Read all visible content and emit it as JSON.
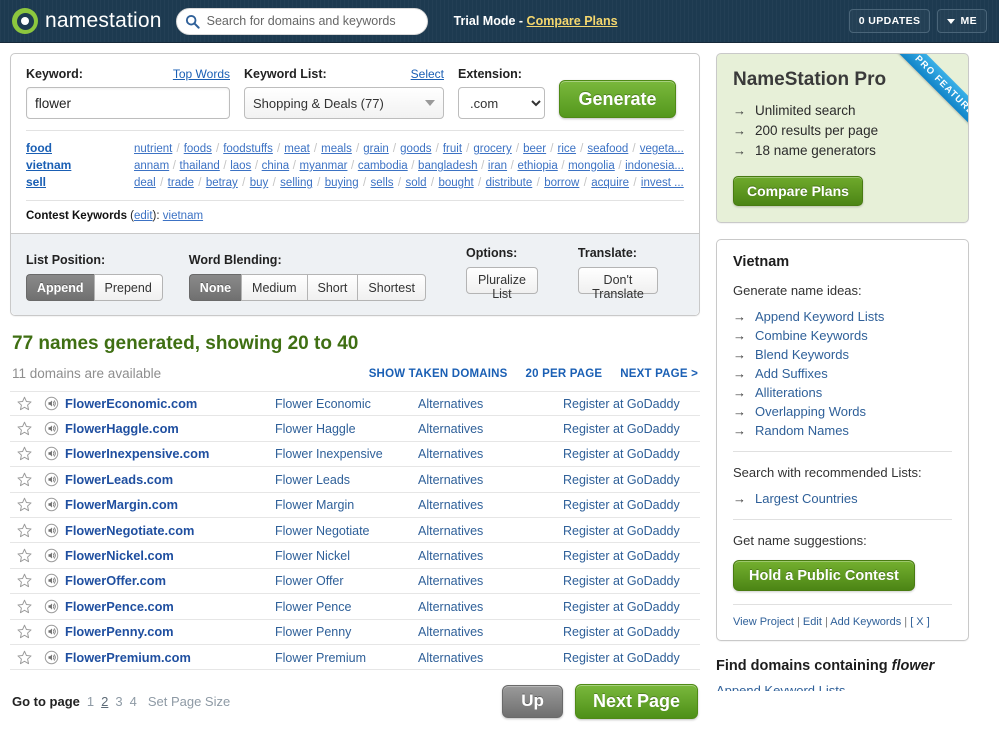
{
  "topbar": {
    "logo_text": "namestation",
    "logo_icon": "namestation-circle-logo",
    "search_placeholder": "Search for domains and keywords",
    "search_value": "",
    "search_icon": "search-icon",
    "trial_prefix": "Trial Mode - ",
    "trial_link": "Compare Plans",
    "updates_label": "0 UPDATES",
    "me_label": "ME",
    "me_caret_icon": "chevron-down-icon"
  },
  "generator": {
    "keyword_label": "Keyword:",
    "top_words_link": "Top Words",
    "keyword_value": "flower",
    "keyword_list_label": "Keyword List:",
    "select_link": "Select",
    "keyword_list_value": "Shopping & Deals (77)",
    "keyword_list_options": [
      "Shopping & Deals (77)"
    ],
    "extension_label": "Extension:",
    "extension_value": ".com",
    "extension_options": [
      ".com"
    ],
    "generate_label": "Generate",
    "keyword_rows": [
      {
        "head": "food",
        "words": [
          "nutrient",
          "foods",
          "foodstuffs",
          "meat",
          "meals",
          "grain",
          "goods",
          "fruit",
          "grocery",
          "beer",
          "rice",
          "seafood",
          "vegeta..."
        ]
      },
      {
        "head": "vietnam",
        "words": [
          "annam",
          "thailand",
          "laos",
          "china",
          "myanmar",
          "cambodia",
          "bangladesh",
          "iran",
          "ethiopia",
          "mongolia",
          "indonesia..."
        ]
      },
      {
        "head": "sell",
        "words": [
          "deal",
          "trade",
          "betray",
          "buy",
          "selling",
          "buying",
          "sells",
          "sold",
          "bought",
          "distribute",
          "borrow",
          "acquire",
          "invest ..."
        ]
      }
    ],
    "contest_label": "Contest Keywords",
    "contest_edit": "edit",
    "contest_value": "vietnam"
  },
  "options": {
    "list_position_title": "List Position:",
    "list_position": [
      "Append",
      "Prepend"
    ],
    "list_position_selected": "Append",
    "word_blending_title": "Word Blending:",
    "word_blending": [
      "None",
      "Medium",
      "Short",
      "Shortest"
    ],
    "word_blending_selected": "None",
    "options_title": "Options:",
    "pluralize_label": "Pluralize List",
    "translate_title": "Translate:",
    "translate_label": "Don't Translate"
  },
  "results": {
    "title": "77 names generated, showing 20 to 40",
    "available_text": "11 domains are available",
    "actions": [
      "SHOW TAKEN DOMAINS",
      "20 PER PAGE",
      "NEXT PAGE >"
    ],
    "star_icon": "star-outline-icon",
    "speaker_icon": "speaker-icon",
    "alternatives_label": "Alternatives",
    "register_label": "Register at GoDaddy",
    "rows": [
      {
        "domain": "FlowerEconomic.com",
        "phrase": "Flower Economic"
      },
      {
        "domain": "FlowerHaggle.com",
        "phrase": "Flower Haggle"
      },
      {
        "domain": "FlowerInexpensive.com",
        "phrase": "Flower Inexpensive"
      },
      {
        "domain": "FlowerLeads.com",
        "phrase": "Flower Leads"
      },
      {
        "domain": "FlowerMargin.com",
        "phrase": "Flower Margin"
      },
      {
        "domain": "FlowerNegotiate.com",
        "phrase": "Flower Negotiate"
      },
      {
        "domain": "FlowerNickel.com",
        "phrase": "Flower Nickel"
      },
      {
        "domain": "FlowerOffer.com",
        "phrase": "Flower Offer"
      },
      {
        "domain": "FlowerPence.com",
        "phrase": "Flower Pence"
      },
      {
        "domain": "FlowerPenny.com",
        "phrase": "Flower Penny"
      },
      {
        "domain": "FlowerPremium.com",
        "phrase": "Flower Premium"
      }
    ]
  },
  "pager": {
    "go_to_page_label": "Go to page",
    "pages": [
      "1",
      "2",
      "3",
      "4"
    ],
    "current_page": "2",
    "set_page_size_label": "Set Page Size",
    "up_label": "Up",
    "next_label": "Next Page"
  },
  "sidebar": {
    "pro": {
      "title": "NameStation Pro",
      "ribbon": "PRO FEATURE",
      "features": [
        "Unlimited search",
        "200 results per page",
        "18 name generators"
      ],
      "compare_label": "Compare Plans"
    },
    "project": {
      "title": "Vietnam",
      "generate_label": "Generate name ideas:",
      "generators": [
        "Append Keyword Lists",
        "Combine Keywords",
        "Blend Keywords",
        "Add Suffixes",
        "Alliterations",
        "Overlapping Words",
        "Random Names"
      ],
      "recommended_label": "Search with recommended Lists:",
      "recommended": [
        "Largest Countries"
      ],
      "suggestions_label": "Get name suggestions:",
      "contest_button": "Hold a Public Contest",
      "footer_links": [
        "View Project",
        "Edit",
        "Add Keywords",
        "[ X ]"
      ]
    },
    "find": {
      "title_prefix": "Find domains containing ",
      "title_term": "flower",
      "peek_link": "Append Keyword Lists"
    }
  },
  "colors": {
    "header_bg": "#1d3a50",
    "green": "#5d9e21",
    "link_blue": "#2f6099",
    "result_title_green": "#3f6f13",
    "pro_panel_bg": "#e7f0d8",
    "ribbon_blue": "#1184c8"
  }
}
